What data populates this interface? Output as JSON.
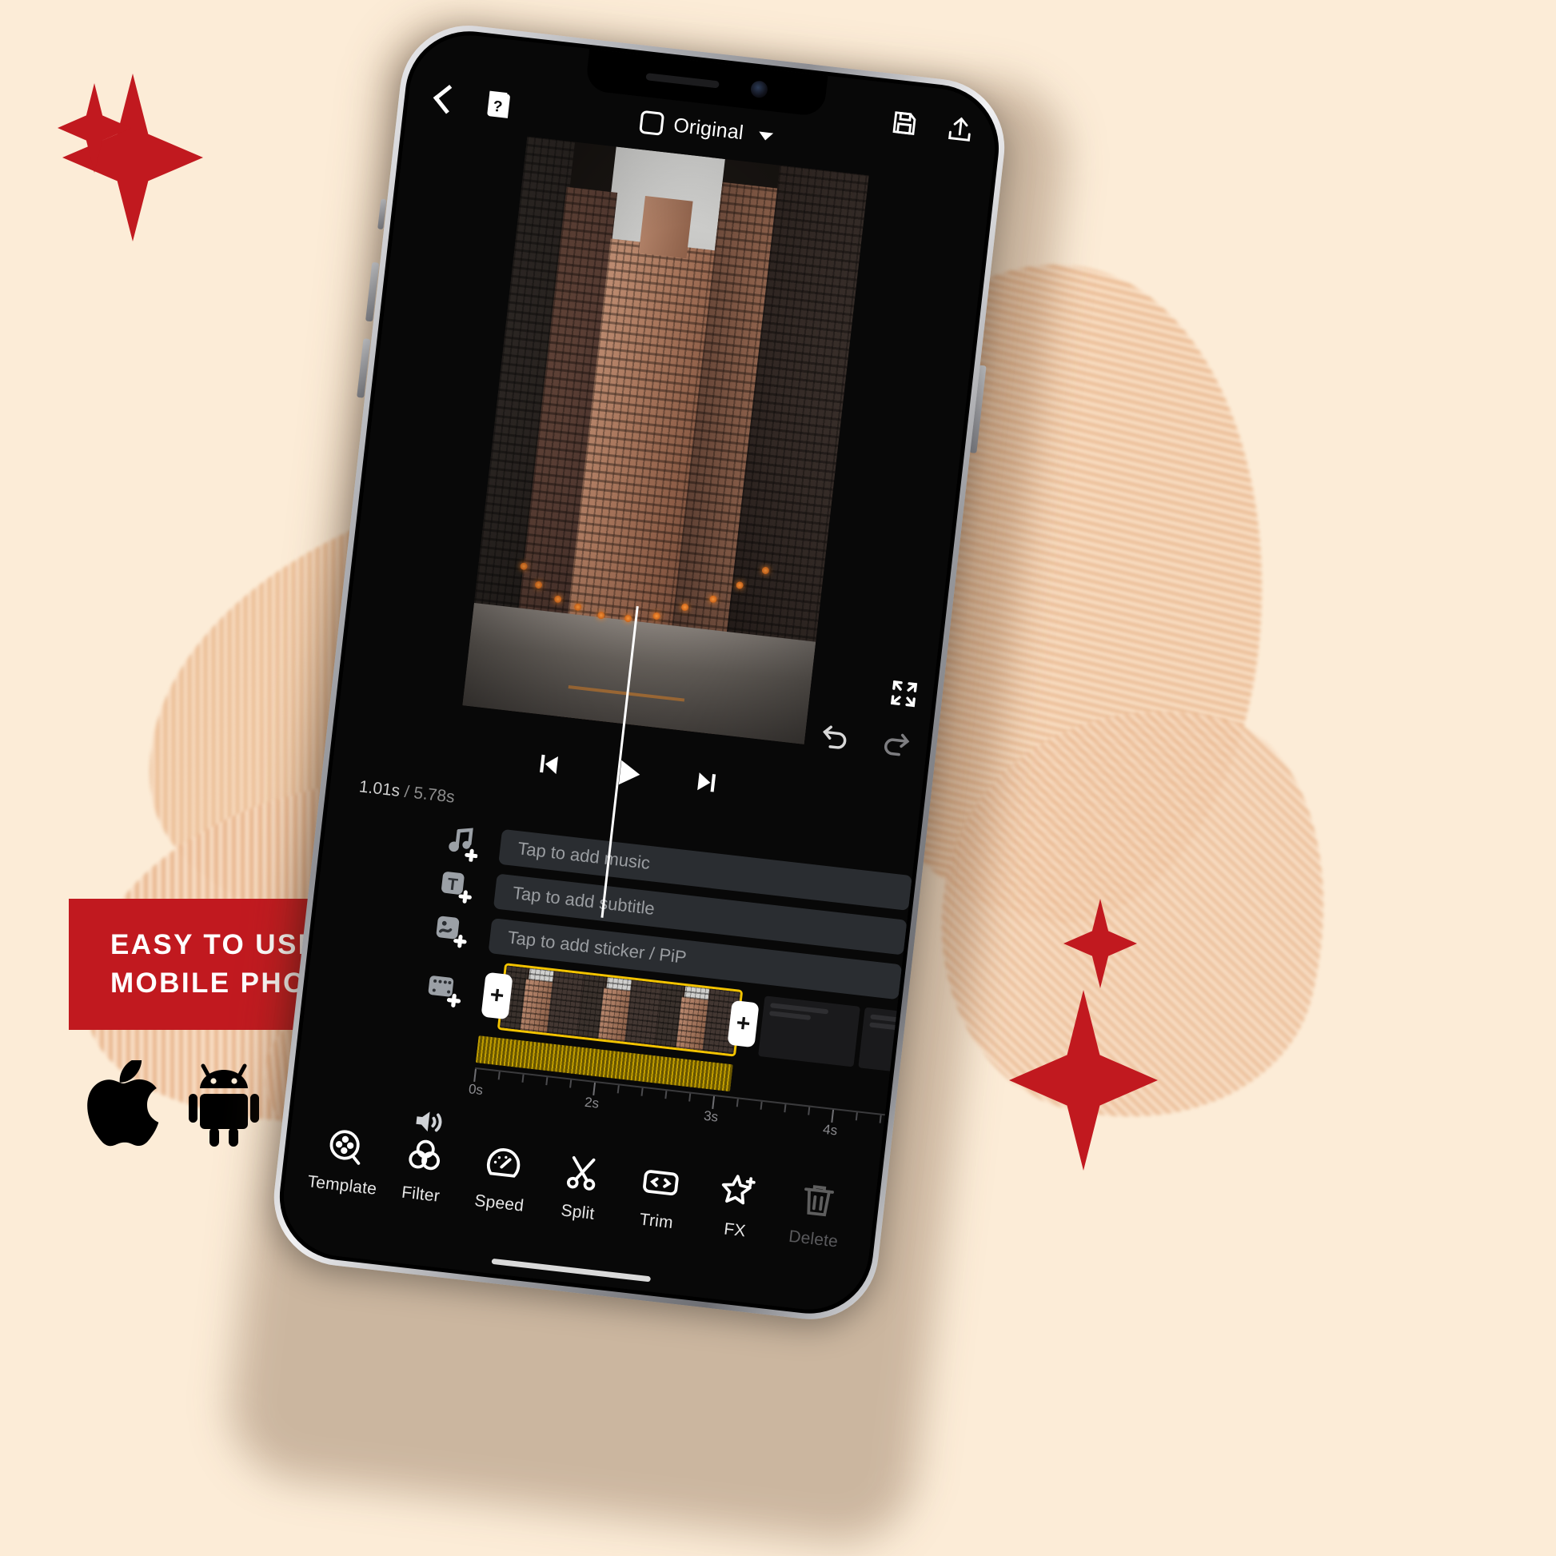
{
  "promo": {
    "banner_line_1": "Easy to use with your",
    "banner_line_2": "mobile phone!",
    "banner_color": "#c1191f",
    "background_color": "#fcecd7",
    "badges": [
      {
        "name": "apple-app-store-badge",
        "glyph": ""
      },
      {
        "name": "google-play-android-badge",
        "glyph": ""
      }
    ]
  },
  "app": {
    "topbar": {
      "back_label": "Back",
      "tutorial_label": "Tutorial",
      "aspect_ratio": "Original",
      "save_label": "Save",
      "export_label": "Export"
    },
    "player": {
      "current_time": "1.01s",
      "separator": "/",
      "total_time": "5.78s",
      "prev_label": "Previous frame",
      "play_label": "Play",
      "next_label": "Next frame",
      "undo_label": "Undo",
      "redo_label": "Redo",
      "fullscreen_label": "Fullscreen"
    },
    "tracks": [
      {
        "icon": "music-note-add-icon",
        "placeholder": "Tap to add music"
      },
      {
        "icon": "text-add-icon",
        "placeholder": "Tap to add subtitle"
      },
      {
        "icon": "sticker-add-icon",
        "placeholder": "Tap to add sticker / PiP"
      },
      {
        "icon": "film-add-icon",
        "placeholder": ""
      },
      {
        "icon": "volume-icon",
        "placeholder": ""
      }
    ],
    "clip": {
      "selected": true,
      "selection_color": "#f3c300",
      "left_handle": "+",
      "right_handle": "+"
    },
    "ruler": {
      "ticks": [
        "0s",
        "2s",
        "3s",
        "4s"
      ],
      "tick_positions": [
        0,
        2,
        3,
        4
      ],
      "max": 5
    },
    "toolbar": [
      {
        "label": "Template",
        "icon": "template-reel-icon",
        "disabled": false
      },
      {
        "label": "Filter",
        "icon": "filter-circles-icon",
        "disabled": false
      },
      {
        "label": "Speed",
        "icon": "speedometer-icon",
        "disabled": false
      },
      {
        "label": "Split",
        "icon": "scissors-icon",
        "disabled": false
      },
      {
        "label": "Trim",
        "icon": "trim-brackets-icon",
        "disabled": false
      },
      {
        "label": "FX",
        "icon": "star-fx-icon",
        "disabled": false
      },
      {
        "label": "Delete",
        "icon": "trash-icon",
        "disabled": true
      }
    ]
  }
}
